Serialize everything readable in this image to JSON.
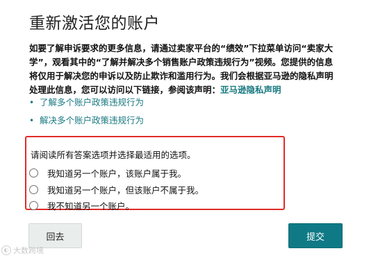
{
  "page_title": "重新激活您的账户",
  "intro": {
    "text": "如要了解申诉要求的更多信息，请通过卖家平台的“绩效”下拉菜单访问“卖家大学”，观看其中的“了解并解决多个销售账户政策违规行为”视频。您提供的信息将仅用于解决您的申诉以及防止欺诈和滥用行为。我们会根据亚马逊的隐私声明处理此信息，您可以访问以下链接，参阅该声明：",
    "privacy_link": "亚马逊隐私声明"
  },
  "links": [
    {
      "bullet": "•",
      "label": "了解多个账户政策违规行为"
    },
    {
      "bullet": "•",
      "label": "解决多个账户政策违规行为"
    }
  ],
  "question": {
    "prompt": "请阅读所有答案选项并选择最适用的选项。",
    "options": [
      {
        "label": "我知道另一个账户，该账户属于我。",
        "selected": false
      },
      {
        "label": "我知道另一个账户，但该账户不属于我。",
        "selected": false
      },
      {
        "label": "我不知道另一个账户。",
        "selected": false
      }
    ]
  },
  "buttons": {
    "back": "回去",
    "submit": "提交"
  },
  "watermark": {
    "icon": "watermark-logo-icon",
    "text": "大数跨境"
  },
  "colors": {
    "link": "#1a7a82",
    "highlight_border": "#e02b27",
    "primary_button": "#0f7a85",
    "secondary_button": "#e9eeed"
  }
}
